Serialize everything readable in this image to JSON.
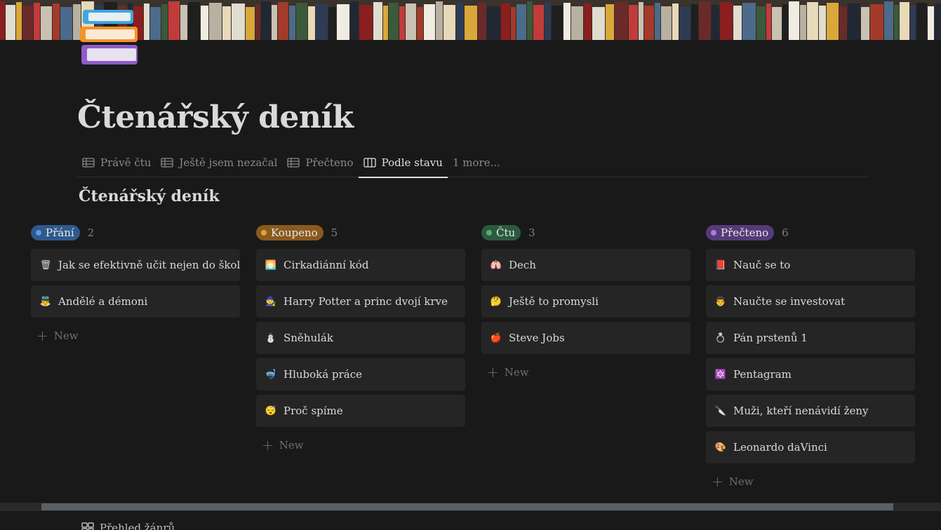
{
  "page": {
    "title": "Čtenářský deník",
    "icon": "books-icon"
  },
  "tabs": [
    {
      "label": "Právě čtu",
      "icon": "table-icon",
      "active": false
    },
    {
      "label": "Ještě jsem nezačal",
      "icon": "table-icon",
      "active": false
    },
    {
      "label": "Přečteno",
      "icon": "table-icon",
      "active": false
    },
    {
      "label": "Podle stavu",
      "icon": "board-icon",
      "active": true
    },
    {
      "label": "1 more...",
      "icon": "",
      "active": false
    }
  ],
  "database": {
    "title": "Čtenářský deník"
  },
  "board": {
    "new_label": "New",
    "columns": [
      {
        "label": "Přání",
        "count": "2",
        "color": "#2e5a8c",
        "dot": "#5a9ae6",
        "cards": [
          {
            "title": "Jak se efektivně učit nejen do školy",
            "icon": "trash-can-icon",
            "glyph": "🗑"
          },
          {
            "title": "Andělé a démoni",
            "icon": "angel-icon",
            "glyph": "👼"
          }
        ]
      },
      {
        "label": "Koupeno",
        "count": "5",
        "color": "#8a5a1e",
        "dot": "#e0a23c",
        "cards": [
          {
            "title": "Cirkadiánní kód",
            "icon": "sunrise-icon",
            "glyph": "🌅"
          },
          {
            "title": "Harry Potter a princ dvojí krve",
            "icon": "wizard-icon",
            "glyph": "🧙"
          },
          {
            "title": "Sněhulák",
            "icon": "snowman-icon",
            "glyph": "⛄"
          },
          {
            "title": "Hluboká práce",
            "icon": "diving-mask-icon",
            "glyph": "🤿"
          },
          {
            "title": "Proč spíme",
            "icon": "sleeping-face-icon",
            "glyph": "😴"
          }
        ]
      },
      {
        "label": "Čtu",
        "count": "3",
        "color": "#2c5a3e",
        "dot": "#4fb07a",
        "cards": [
          {
            "title": "Dech",
            "icon": "lungs-icon",
            "glyph": "🫁"
          },
          {
            "title": "Ještě to promysli",
            "icon": "thinking-face-icon",
            "glyph": "🤔"
          },
          {
            "title": "Steve Jobs",
            "icon": "apple-icon",
            "glyph": "🍎"
          }
        ]
      },
      {
        "label": "Přečteno",
        "count": "6",
        "color": "#553a78",
        "dot": "#a67ee0",
        "cards": [
          {
            "title": "Nauč se to",
            "icon": "book-icon",
            "glyph": "📕"
          },
          {
            "title": "Naučte se investovat",
            "icon": "businessman-icon",
            "glyph": "👨"
          },
          {
            "title": "Pán prstenů 1",
            "icon": "ring-icon",
            "glyph": "💍"
          },
          {
            "title": "Pentagram",
            "icon": "star-of-david-icon",
            "glyph": "🔯"
          },
          {
            "title": "Muži, kteří nenávidí ženy",
            "icon": "knife-icon",
            "glyph": "🔪"
          },
          {
            "title": "Leonardo daVinci",
            "icon": "palette-icon",
            "glyph": "🎨"
          }
        ]
      }
    ]
  },
  "footer": {
    "label": "Přehled žánrů",
    "icon": "gallery-icon"
  }
}
